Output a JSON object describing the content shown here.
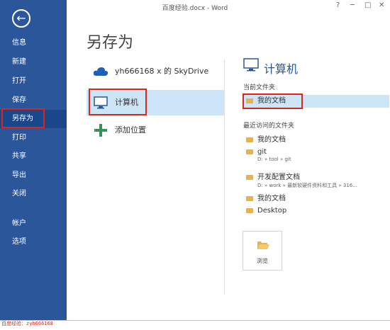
{
  "window": {
    "title": "百度经验.docx - Word",
    "help": "?",
    "minimize": "─",
    "maximize": "□",
    "close": "✕"
  },
  "sidebar": {
    "items": [
      {
        "label": "信息"
      },
      {
        "label": "新建"
      },
      {
        "label": "打开"
      },
      {
        "label": "保存"
      },
      {
        "label": "另存为"
      },
      {
        "label": "打印"
      },
      {
        "label": "共享"
      },
      {
        "label": "导出"
      },
      {
        "label": "关闭"
      },
      {
        "label": "帐户"
      },
      {
        "label": "选项"
      }
    ]
  },
  "page_title": "另存为",
  "locations": [
    {
      "label": "yh666168 x 的 SkyDrive",
      "icon": "cloud-icon"
    },
    {
      "label": "计算机",
      "icon": "computer-icon"
    },
    {
      "label": "添加位置",
      "icon": "plus-icon"
    }
  ],
  "right_panel": {
    "title": "计算机",
    "current_folder_label": "当前文件夹",
    "current_folder": "我的文档",
    "recent_label": "最近访问的文件夹",
    "recent": [
      {
        "name": "我的文档",
        "path": ""
      },
      {
        "name": "git",
        "path": "D: » tool » git"
      },
      {
        "name": "开发配置文档",
        "path": "D: » work » 最新软硬件资料和工具 » 316..."
      },
      {
        "name": "我的文档",
        "path": ""
      },
      {
        "name": "Desktop",
        "path": ""
      }
    ],
    "browse_label": "浏览"
  },
  "watermark": "百度经验：zyh666168",
  "colors": {
    "sidebar": "#2b579a",
    "active": "#19478a",
    "highlight": "#d9271c",
    "selected": "#cde6f7"
  }
}
